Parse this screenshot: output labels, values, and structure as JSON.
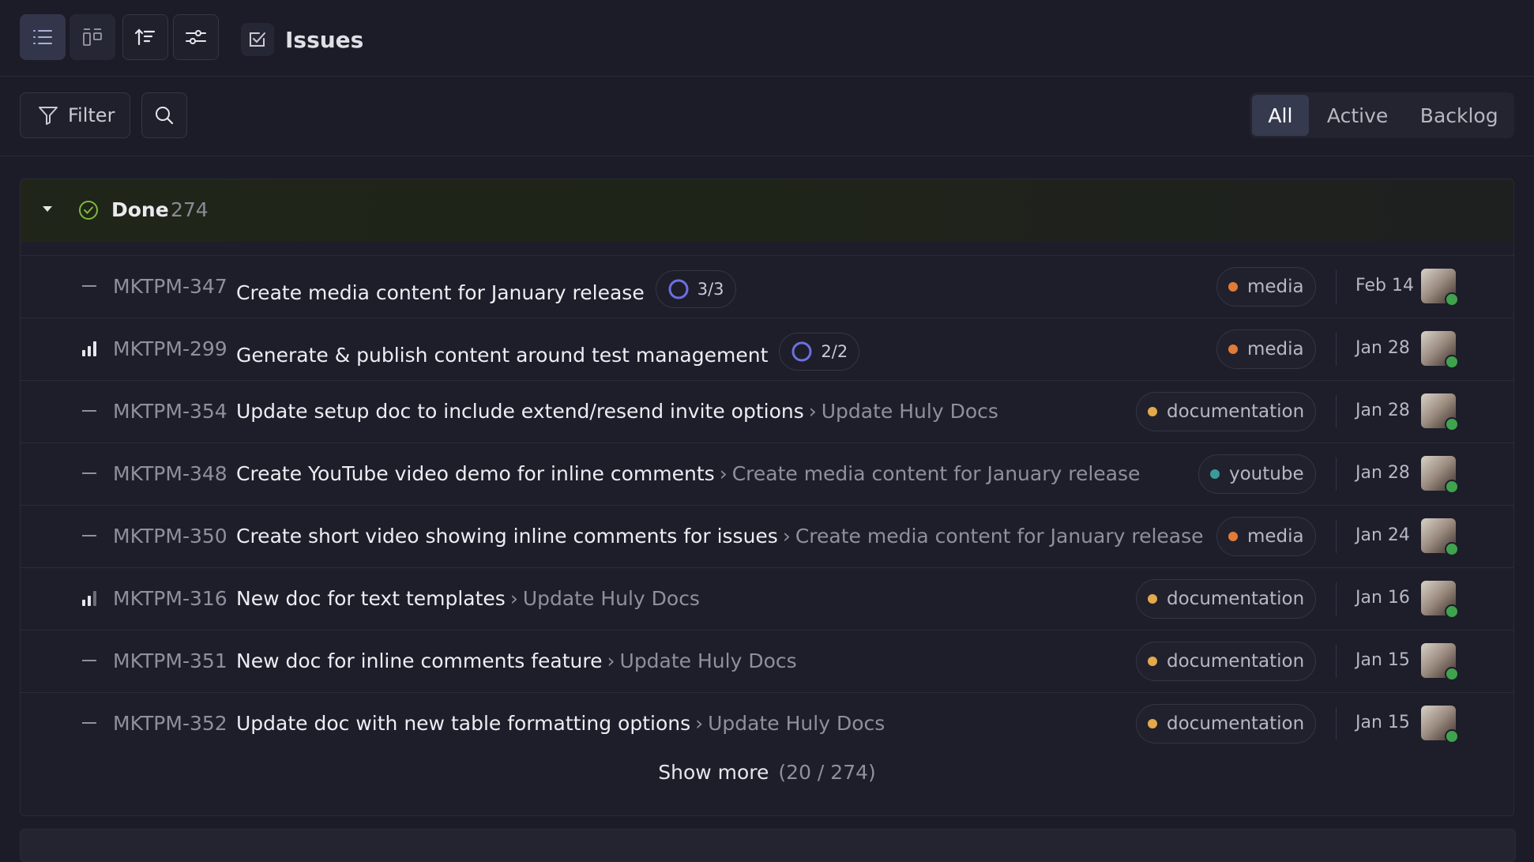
{
  "header": {
    "title": "Issues"
  },
  "filterbar": {
    "filter_label": "Filter",
    "tabs": [
      {
        "label": "All",
        "active": true
      },
      {
        "label": "Active",
        "active": false
      },
      {
        "label": "Backlog",
        "active": false
      }
    ]
  },
  "group": {
    "title": "Done",
    "count": "274"
  },
  "rows": [
    {
      "id": "MKTPM-347",
      "title": "Create media content for January release",
      "parent": "",
      "subissues": "3/3",
      "priority": "none",
      "label": "media",
      "label_color": "#e07b3a",
      "date": "Feb 14"
    },
    {
      "id": "MKTPM-299",
      "title": "Generate & publish content around test management",
      "parent": "",
      "subissues": "2/2",
      "priority": "high",
      "label": "media",
      "label_color": "#e07b3a",
      "date": "Jan 28"
    },
    {
      "id": "MKTPM-354",
      "title": "Update setup doc to include extend/resend invite options",
      "parent": "Update Huly Docs",
      "subissues": "",
      "priority": "none",
      "label": "documentation",
      "label_color": "#e3a94a",
      "date": "Jan 28"
    },
    {
      "id": "MKTPM-348",
      "title": "Create YouTube video demo for inline comments",
      "parent": "Create media content for January release",
      "subissues": "",
      "priority": "none",
      "label": "youtube",
      "label_color": "#3b9b9b",
      "date": "Jan 28"
    },
    {
      "id": "MKTPM-350",
      "title": "Create short video showing inline comments for issues",
      "parent": "Create media content for January release",
      "subissues": "",
      "priority": "none",
      "label": "media",
      "label_color": "#e07b3a",
      "date": "Jan 24"
    },
    {
      "id": "MKTPM-316",
      "title": "New doc for text templates",
      "parent": "Update Huly Docs",
      "subissues": "",
      "priority": "medium",
      "label": "documentation",
      "label_color": "#e3a94a",
      "date": "Jan 16"
    },
    {
      "id": "MKTPM-351",
      "title": "New doc for inline comments feature",
      "parent": "Update Huly Docs",
      "subissues": "",
      "priority": "none",
      "label": "documentation",
      "label_color": "#e3a94a",
      "date": "Jan 15"
    },
    {
      "id": "MKTPM-352",
      "title": "Update doc with new table formatting options",
      "parent": "Update Huly Docs",
      "subissues": "",
      "priority": "none",
      "label": "documentation",
      "label_color": "#e3a94a",
      "date": "Jan 15"
    }
  ],
  "show_more": {
    "label": "Show more",
    "count": "(20 / 274)"
  }
}
